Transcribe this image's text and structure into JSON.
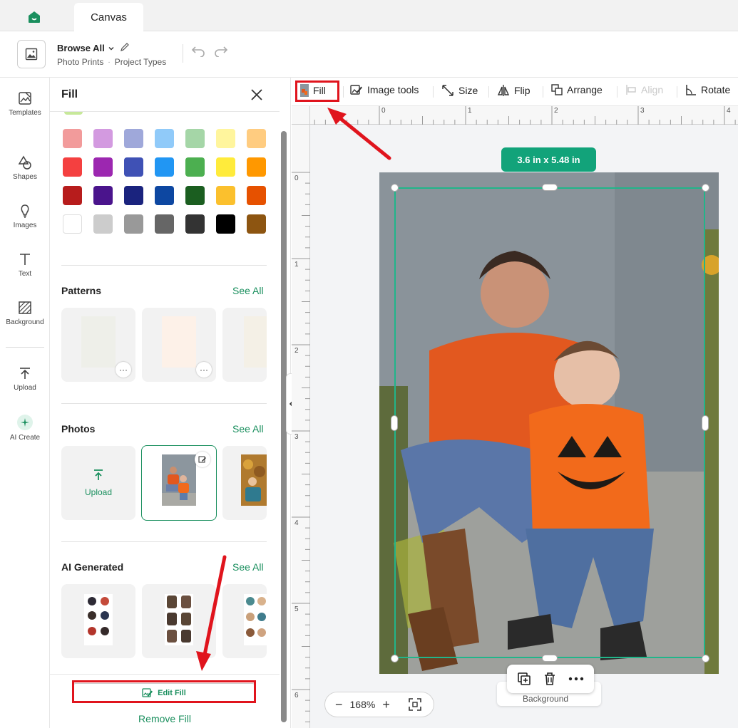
{
  "colors": {
    "accent": "#1a8f5e",
    "selection": "#21b58a",
    "size_badge": "#12a37a",
    "annotation": "#e0141d"
  },
  "tabs": [
    {
      "label": "Canvas"
    }
  ],
  "header": {
    "title": "Browse All",
    "breadcrumb": [
      "Photo Prints",
      "Project Types"
    ]
  },
  "rail": {
    "items": [
      {
        "label": "Templates",
        "icon": "templates-icon"
      },
      {
        "label": "Shapes",
        "icon": "shapes-icon"
      },
      {
        "label": "Images",
        "icon": "images-icon"
      },
      {
        "label": "Text",
        "icon": "text-icon"
      },
      {
        "label": "Background",
        "icon": "background-icon"
      },
      {
        "label": "Upload",
        "icon": "upload-icon"
      },
      {
        "label": "AI Create",
        "icon": "ai-create-icon"
      }
    ]
  },
  "panel": {
    "title": "Fill",
    "swatches": [
      "#f29b9b",
      "#d39ae0",
      "#9fa8da",
      "#90caf9",
      "#a5d6a7",
      "#fff59d",
      "#ffcc80",
      "#f44040",
      "#9c27b0",
      "#3f51b5",
      "#2196f3",
      "#4caf50",
      "#ffeb3b",
      "#ff9800",
      "#b71c1c",
      "#4a148c",
      "#1a237e",
      "#0d47a1",
      "#1b5e20",
      "#fbc02d",
      "#e65100",
      "#ffffff",
      "#cccccc",
      "#999999",
      "#666666",
      "#333333",
      "#000000",
      "#8d5511"
    ],
    "sections": {
      "patterns": {
        "title": "Patterns",
        "see_all": "See All"
      },
      "photos": {
        "title": "Photos",
        "see_all": "See All",
        "upload_label": "Upload"
      },
      "ai": {
        "title": "AI Generated",
        "see_all": "See All"
      }
    },
    "edit_fill": "Edit Fill",
    "remove_fill": "Remove Fill"
  },
  "toolbar": {
    "fill": "Fill",
    "image_tools": "Image tools",
    "size": "Size",
    "flip": "Flip",
    "arrange": "Arrange",
    "align": "Align",
    "rotate": "Rotate"
  },
  "canvas": {
    "ruler_top": [
      "0",
      "1",
      "2",
      "3",
      "4"
    ],
    "ruler_left": [
      "0",
      "1",
      "2",
      "3",
      "4",
      "5",
      "6"
    ],
    "size_badge": "3.6  in x 5.48  in",
    "bg_chip": "Background",
    "zoom": "168%"
  }
}
